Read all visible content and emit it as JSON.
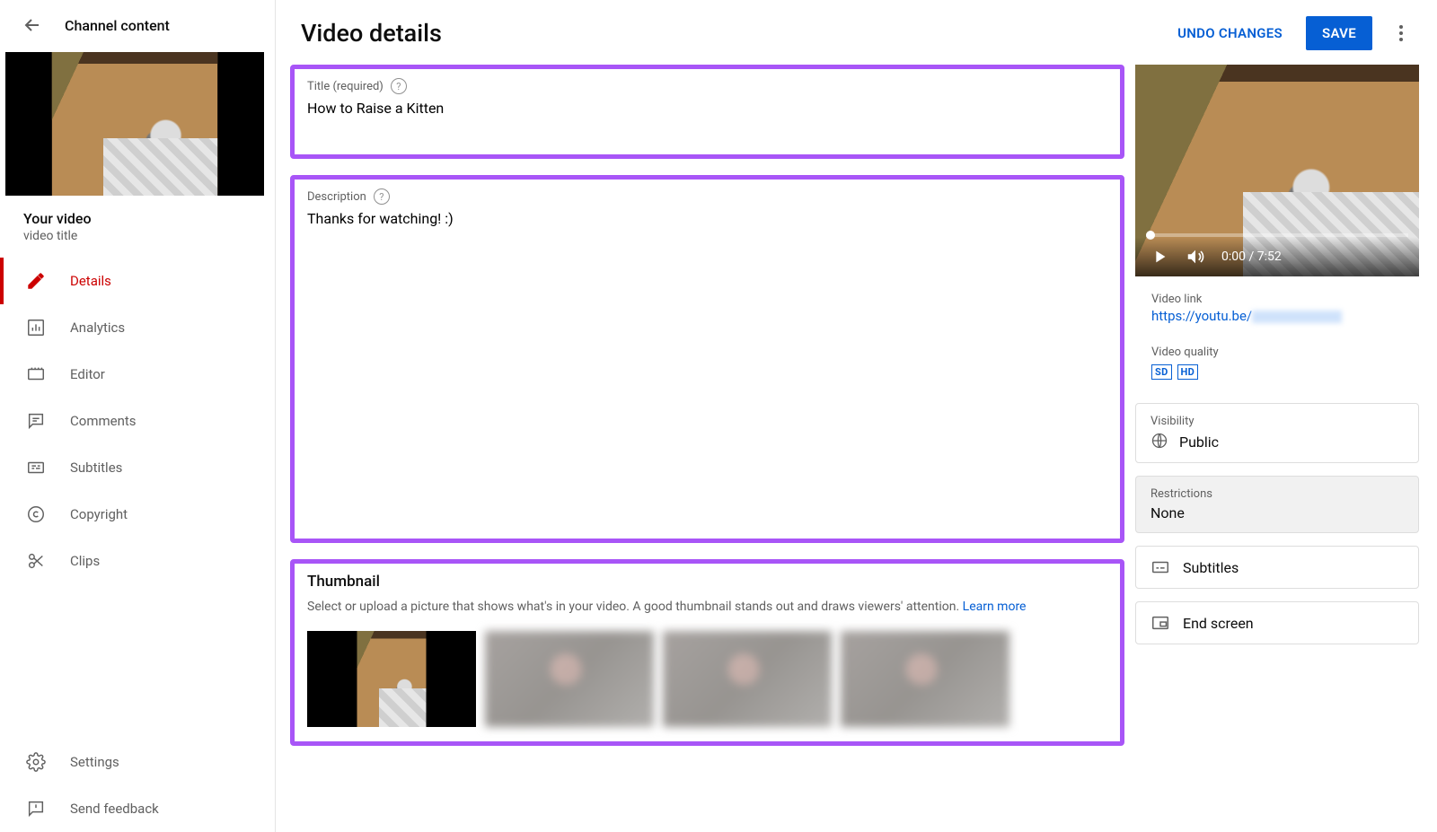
{
  "sidebar": {
    "back_label": "Channel content",
    "your_video_heading": "Your video",
    "your_video_sub": "video title",
    "items": [
      {
        "label": "Details"
      },
      {
        "label": "Analytics"
      },
      {
        "label": "Editor"
      },
      {
        "label": "Comments"
      },
      {
        "label": "Subtitles"
      },
      {
        "label": "Copyright"
      },
      {
        "label": "Clips"
      }
    ],
    "footer": [
      {
        "label": "Settings"
      },
      {
        "label": "Send feedback"
      }
    ]
  },
  "header": {
    "title": "Video details",
    "undo_label": "UNDO CHANGES",
    "save_label": "SAVE"
  },
  "fields": {
    "title_label": "Title (required)",
    "title_value": "How to Raise a Kitten",
    "desc_label": "Description",
    "desc_value": "Thanks for watching! :)"
  },
  "thumbnail": {
    "heading": "Thumbnail",
    "text": "Select or upload a picture that shows what's in your video. A good thumbnail stands out and draws viewers' attention. ",
    "learn_more": "Learn more"
  },
  "preview": {
    "time": "0:00 / 7:52"
  },
  "meta": {
    "link_label": "Video link",
    "link_value": "https://youtu.be/",
    "quality_label": "Video quality",
    "sd": "SD",
    "hd": "HD"
  },
  "panels": {
    "visibility_label": "Visibility",
    "visibility_value": "Public",
    "restrictions_label": "Restrictions",
    "restrictions_value": "None",
    "subtitles_label": "Subtitles",
    "endscreen_label": "End screen"
  }
}
